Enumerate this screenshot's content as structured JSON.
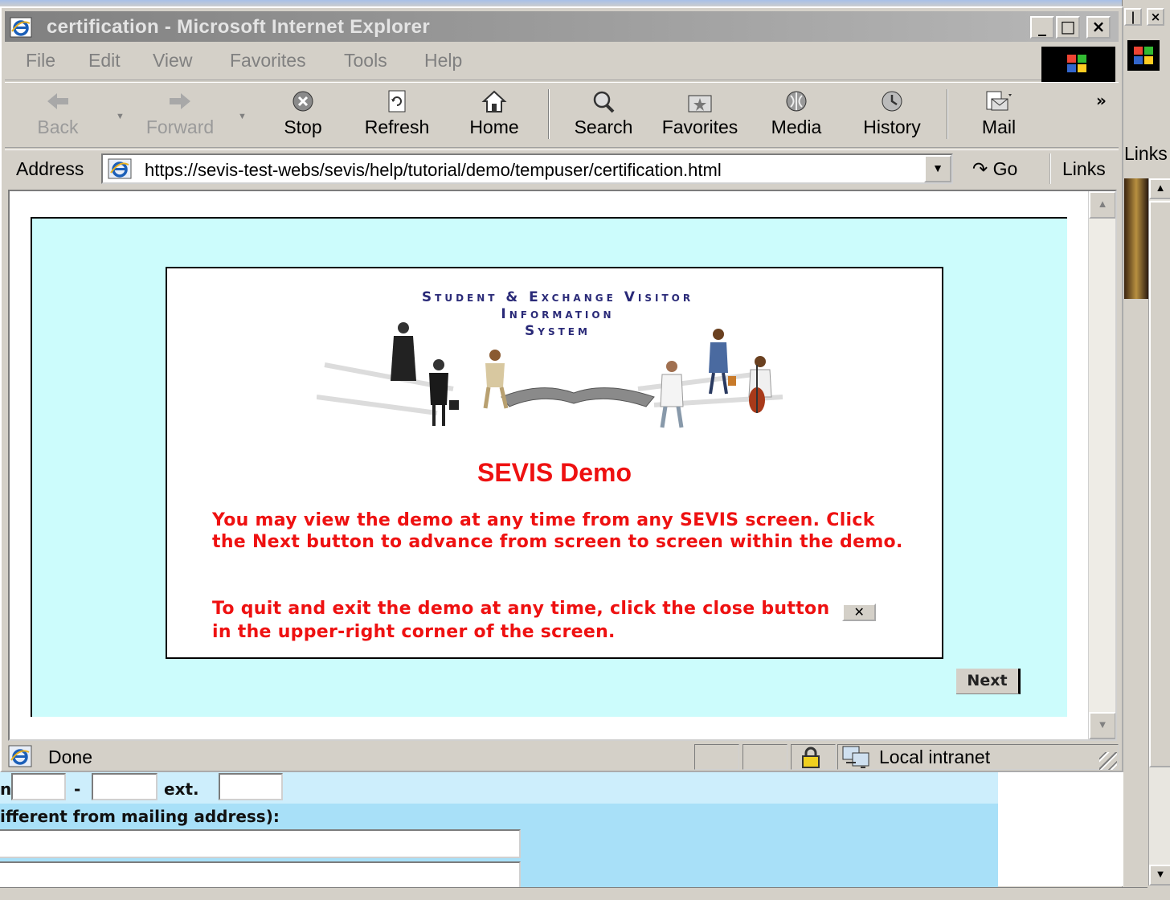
{
  "window": {
    "title": "certification - Microsoft Internet Explorer",
    "minimize": "_",
    "maximize": "□",
    "close": "×"
  },
  "menu": [
    "File",
    "Edit",
    "View",
    "Favorites",
    "Tools",
    "Help"
  ],
  "toolbar": {
    "back": "Back",
    "forward": "Forward",
    "stop": "Stop",
    "refresh": "Refresh",
    "home": "Home",
    "search": "Search",
    "favorites": "Favorites",
    "media": "Media",
    "history": "History",
    "mail": "Mail",
    "more": "»"
  },
  "address": {
    "label": "Address",
    "url": "https://sevis-test-webs/sevis/help/tutorial/demo/tempuser/certification.html",
    "go": "Go",
    "links": "Links"
  },
  "content": {
    "logo_line1": "Student & Exchange Visitor",
    "logo_line2": "Information",
    "logo_line3": "System",
    "title": "SEVIS Demo",
    "para1": "You may view the demo at any time from any SEVIS screen.  Click the Next button to advance from screen to screen within the demo.",
    "para2_before": "To quit and exit the demo at any time, click the close button",
    "close_glyph": "✕",
    "para2_after": "in the upper-right corner of the screen.",
    "next_button": "Next"
  },
  "status": {
    "text": "Done",
    "zone": "Local intranet"
  },
  "background_window": {
    "links": "Links",
    "minimize_partial": "|",
    "close": "×",
    "form_sep": "-",
    "form_ext": "ext.",
    "form_label_left": "n",
    "form_heading": "ifferent from mailing address):"
  },
  "colors": {
    "accent_red": "#ee1111",
    "content_bg": "#ccfcfc",
    "title_bar": "#9a9a9a",
    "form_bg": "#a8e0f8"
  }
}
